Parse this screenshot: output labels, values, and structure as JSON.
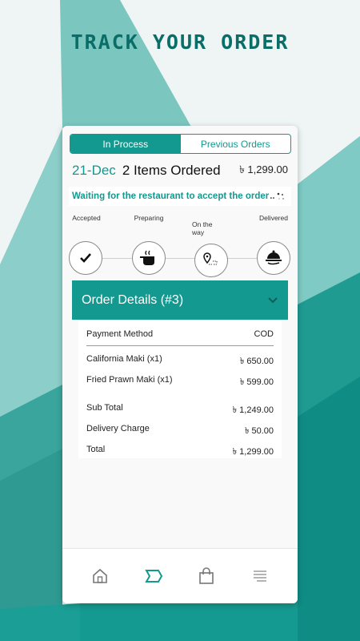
{
  "hero": {
    "title": "TRACK YOUR ORDER"
  },
  "colors": {
    "accent": "#13998f",
    "title": "#0a6e68"
  },
  "tabs": [
    {
      "label": "In Process",
      "active": true
    },
    {
      "label": "Previous Orders",
      "active": false
    }
  ],
  "order": {
    "date": "21-Dec",
    "items": "2 Items Ordered",
    "total": "৳ 1,299.00"
  },
  "status": {
    "message": "Waiting for the restaurant to accept the order",
    "dots": ".."
  },
  "steps": [
    {
      "label": "Accepted",
      "icon": "check-icon"
    },
    {
      "label": "Preparing",
      "icon": "cooking-pot-icon"
    },
    {
      "label": "On the way",
      "icon": "route-pin-icon"
    },
    {
      "label": "Delivered",
      "icon": "serving-cloche-icon"
    }
  ],
  "details": {
    "title": "Order Details (#3)",
    "payment": {
      "label": "Payment Method",
      "value": "COD"
    },
    "items": [
      {
        "name": "California Maki (x1)",
        "price": "৳ 650.00"
      },
      {
        "name": "Fried Prawn Maki (x1)",
        "price": "৳ 599.00"
      }
    ],
    "subtotal": {
      "label": "Sub Total",
      "value": "৳ 1,249.00"
    },
    "delivery": {
      "label": "Delivery Charge",
      "value": "৳ 50.00"
    },
    "total": {
      "label": "Total",
      "value": "৳ 1,299.00"
    }
  },
  "nav": [
    {
      "icon": "home-icon",
      "active": false
    },
    {
      "icon": "orders-tag-icon",
      "active": true
    },
    {
      "icon": "shopping-bag-icon",
      "active": false
    },
    {
      "icon": "menu-lines-icon",
      "active": false
    }
  ]
}
